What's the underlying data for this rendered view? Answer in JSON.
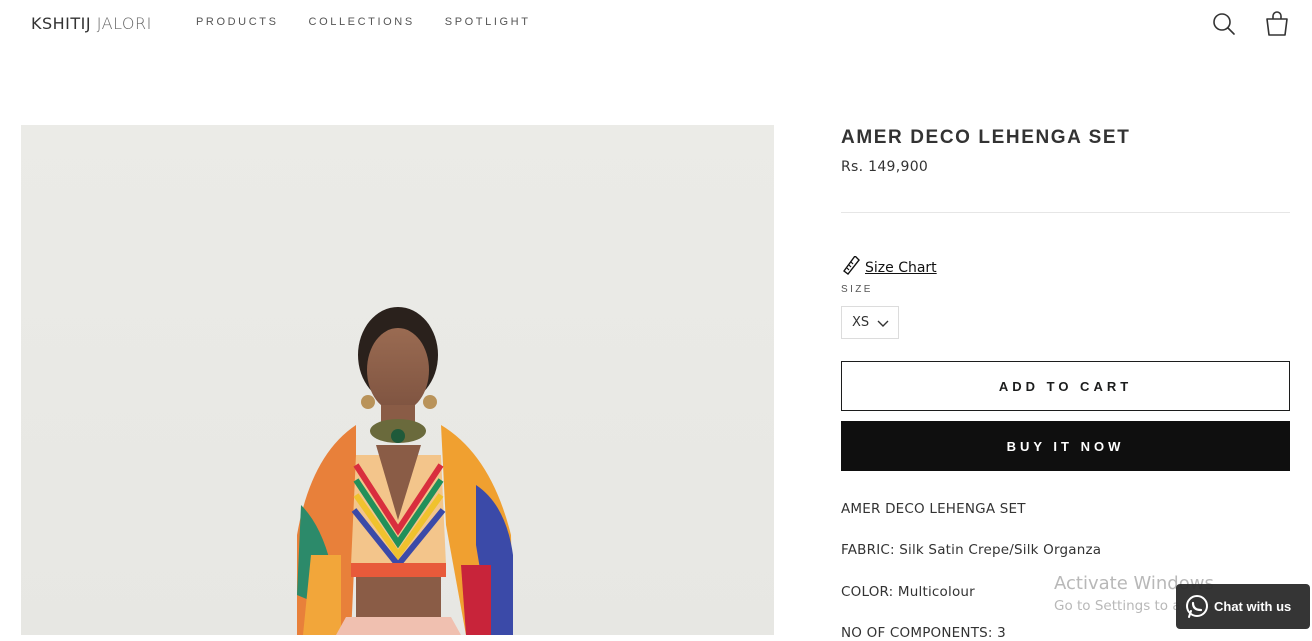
{
  "brand": {
    "first": "KSHITIJ",
    "second": "JALORI"
  },
  "nav": [
    {
      "label": "PRODUCTS"
    },
    {
      "label": "COLLECTIONS"
    },
    {
      "label": "SPOTLIGHT"
    }
  ],
  "header_icons": [
    "search-icon",
    "cart-icon"
  ],
  "product": {
    "title": "AMER DECO LEHENGA SET",
    "price": "Rs. 149,900",
    "size_chart": "Size Chart",
    "size_label": "SIZE",
    "size_value": "XS",
    "add_to_cart": "ADD TO CART",
    "buy_now": "BUY IT NOW",
    "description": [
      "AMER DECO LEHENGA SET",
      "FABRIC: Silk Satin Crepe/Silk Organza",
      "COLOR: Multicolour",
      "NO OF COMPONENTS: 3"
    ]
  },
  "watermark": {
    "line1": "Activate Windows",
    "line2": "Go to Settings to activate Windows."
  },
  "chat": {
    "label": "Chat with us"
  },
  "colors": {
    "button_dark": "#0f0f0f",
    "photo_bg": "#e9e9e5"
  }
}
